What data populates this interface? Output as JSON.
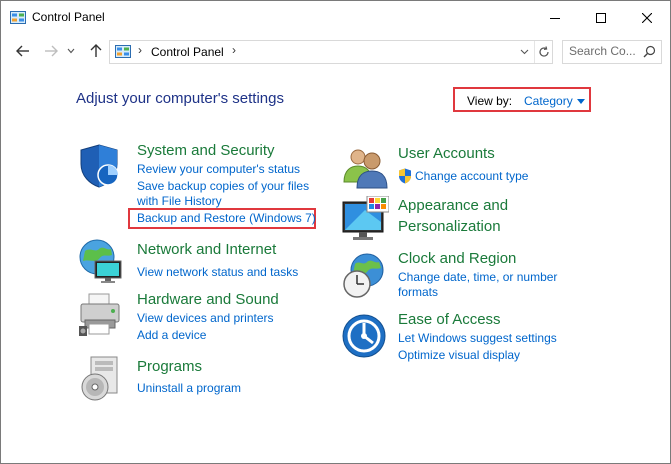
{
  "window": {
    "title": "Control Panel"
  },
  "address": {
    "crumb": "Control Panel",
    "separator": "›"
  },
  "search": {
    "placeholder": "Search Co..."
  },
  "heading": "Adjust your computer's settings",
  "view_by": {
    "label": "View by:",
    "value": "Category"
  },
  "categories": [
    {
      "title": "System and Security",
      "icon": "shield-icon",
      "links": [
        "Review your computer's status",
        "Save backup copies of your files",
        "with File History",
        "Backup and Restore (Windows 7)"
      ]
    },
    {
      "title": "Network and Internet",
      "icon": "network-globe-icon",
      "links": [
        "View network status and tasks"
      ]
    },
    {
      "title": "Hardware and Sound",
      "icon": "printer-icon",
      "links": [
        "View devices and printers",
        "Add a device"
      ]
    },
    {
      "title": "Programs",
      "icon": "programs-disc-icon",
      "links": [
        "Uninstall a program"
      ]
    },
    {
      "title": "User Accounts",
      "icon": "users-icon",
      "links": [
        "Change account type"
      ]
    },
    {
      "title": "Appearance and",
      "title2": "Personalization",
      "icon": "monitor-palette-icon",
      "links": []
    },
    {
      "title": "Clock and Region",
      "icon": "clock-globe-icon",
      "links": [
        "Change date, time, or number",
        "formats"
      ]
    },
    {
      "title": "Ease of Access",
      "icon": "ease-of-access-icon",
      "links": [
        "Let Windows suggest settings",
        "Optimize visual display"
      ]
    }
  ],
  "colors": {
    "heading": "#1e3287",
    "category_title": "#1a7a3a",
    "link": "#0066cc",
    "highlight": "#e0383e"
  }
}
